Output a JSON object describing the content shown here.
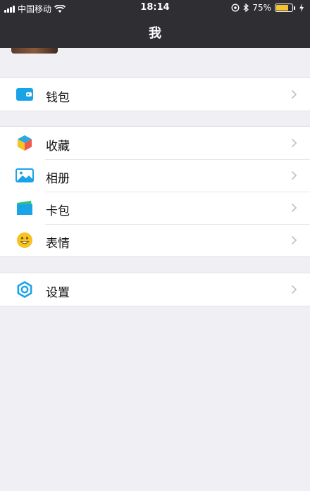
{
  "status_bar": {
    "carrier": "中国移动",
    "time": "18:14",
    "battery_percent": "75%",
    "battery_level": 0.75
  },
  "nav": {
    "title": "我"
  },
  "menu": {
    "wallet": {
      "label": "钱包",
      "icon": "wallet-icon"
    },
    "favorites": {
      "label": "收藏",
      "icon": "cube-icon"
    },
    "album": {
      "label": "相册",
      "icon": "photo-icon"
    },
    "cards": {
      "label": "卡包",
      "icon": "card-icon"
    },
    "stickers": {
      "label": "表情",
      "icon": "smiley-icon"
    },
    "settings": {
      "label": "设置",
      "icon": "gear-icon"
    }
  },
  "colors": {
    "header_bg": "#2f2f33",
    "page_bg": "#efeff4",
    "accent_blue": "#1aa4e8",
    "battery_yellow": "#f4c430"
  }
}
